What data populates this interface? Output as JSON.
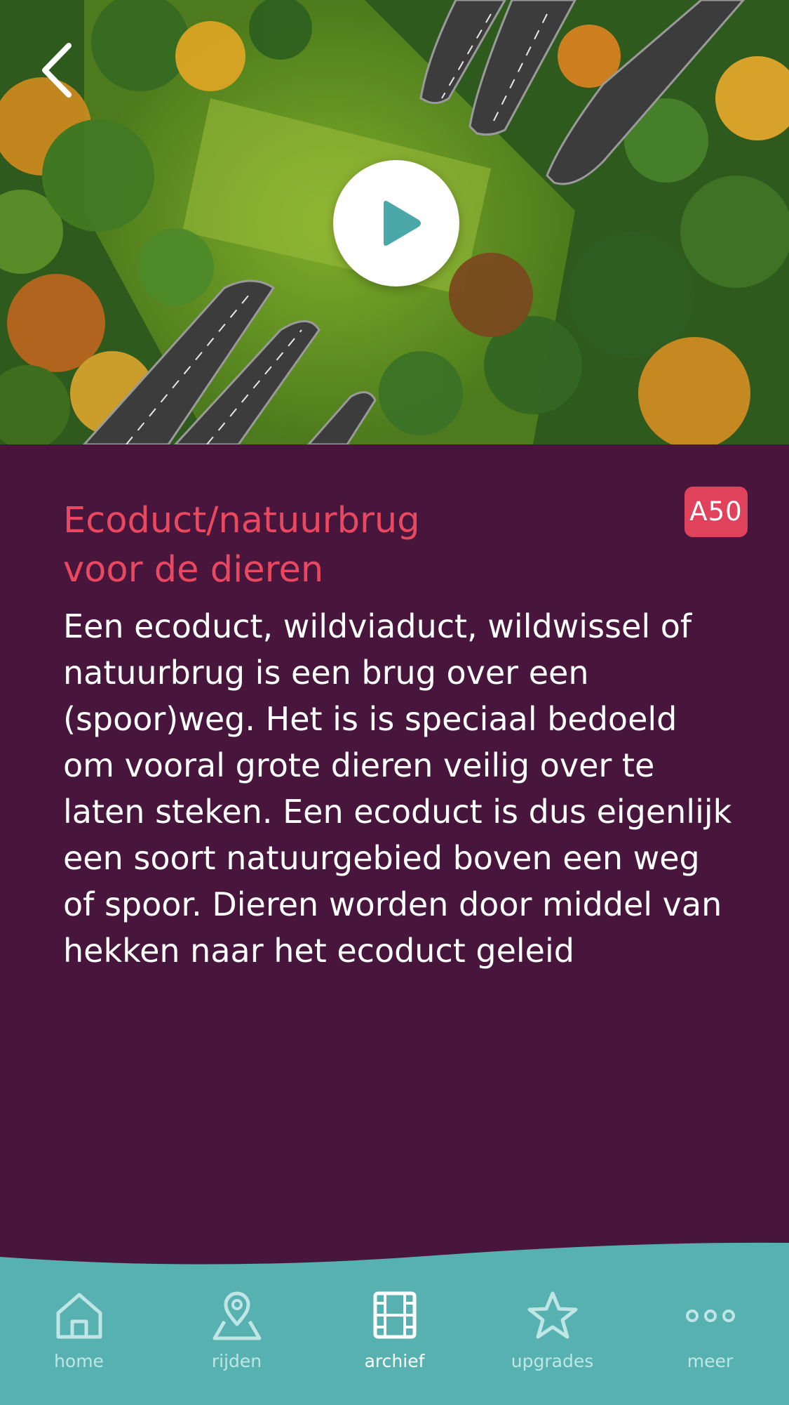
{
  "hero": {
    "image_description_icon": "aerial-forest-highway-photo",
    "back_icon": "chevron-left-icon",
    "play_icon": "play-icon"
  },
  "article": {
    "road_badge": "A50",
    "title_line1": "Ecoduct/natuurbrug",
    "title_line2": "voor de dieren",
    "body": "Een ecoduct, wildviaduct, wildwissel of natuurbrug is een brug over een (spoor)weg. Het is is speciaal bedoeld om vooral grote dieren veilig over te laten steken. Een ecoduct is dus eigenlijk een soort natuurgebied boven een weg of spoor. Dieren worden door middel van hekken naar het ecoduct geleid"
  },
  "colors": {
    "background": "#48163d",
    "title": "#e9485f",
    "badge": "#e0425c",
    "nav": "#56b1b0",
    "nav_label": "#bfe6e4",
    "nav_label_active": "#ffffff",
    "play_triangle": "#4aa9a8"
  },
  "nav": {
    "active": "archief",
    "items": [
      {
        "id": "home",
        "label": "home",
        "icon": "home-icon"
      },
      {
        "id": "rijden",
        "label": "rijden",
        "icon": "map-pin-icon"
      },
      {
        "id": "archief",
        "label": "archief",
        "icon": "film-icon"
      },
      {
        "id": "upgrades",
        "label": "upgrades",
        "icon": "star-icon"
      },
      {
        "id": "meer",
        "label": "meer",
        "icon": "more-dots-icon"
      }
    ]
  }
}
